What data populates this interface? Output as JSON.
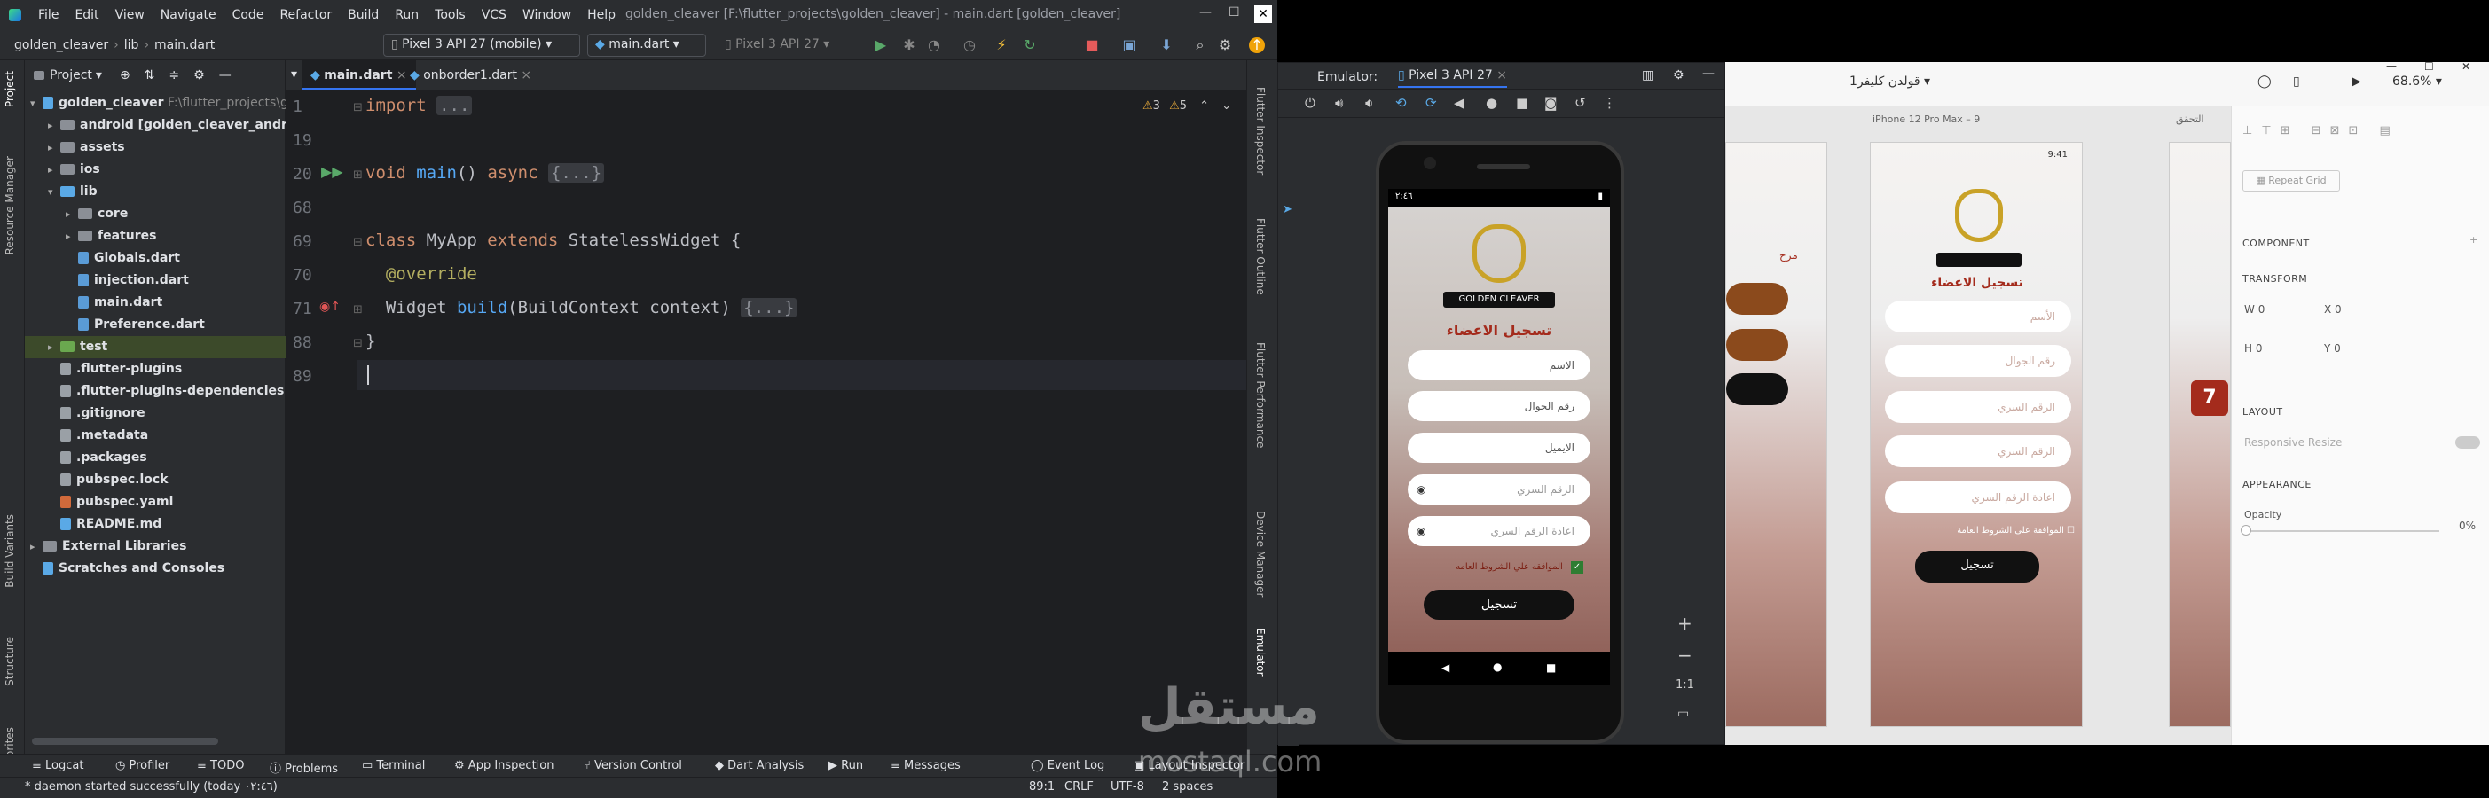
{
  "menu": {
    "items": [
      "File",
      "Edit",
      "View",
      "Navigate",
      "Code",
      "Refactor",
      "Build",
      "Run",
      "Tools",
      "VCS",
      "Window",
      "Help"
    ],
    "title": "golden_cleaver [F:\\flutter_projects\\golden_cleaver] - main.dart [golden_cleaver]"
  },
  "toolbar": {
    "crumbs": [
      "golden_cleaver",
      "lib",
      "main.dart"
    ],
    "device": "Pixel 3 API 27 (mobile)",
    "run_config": "main.dart",
    "emulator_device": "Pixel 3 API 27"
  },
  "side": {
    "project_label": "Project",
    "resource_manager": "Resource Manager",
    "build_variants": "Build Variants",
    "structure": "Structure",
    "favorites": "Favorites"
  },
  "project": {
    "title": "Project",
    "tree": [
      {
        "label": "golden_cleaver",
        "extra": "F:\\flutter_projects\\golden_cleaver"
      },
      {
        "label": "android [golden_cleaver_android]"
      },
      {
        "label": "assets"
      },
      {
        "label": "ios"
      },
      {
        "label": "lib"
      },
      {
        "label": "core"
      },
      {
        "label": "features"
      },
      {
        "label": "Globals.dart"
      },
      {
        "label": "injection.dart"
      },
      {
        "label": "main.dart"
      },
      {
        "label": "Preference.dart"
      },
      {
        "label": "test"
      },
      {
        "label": ".flutter-plugins"
      },
      {
        "label": ".flutter-plugins-dependencies"
      },
      {
        "label": ".gitignore"
      },
      {
        "label": ".metadata"
      },
      {
        "label": ".packages"
      },
      {
        "label": "pubspec.lock"
      },
      {
        "label": "pubspec.yaml"
      },
      {
        "label": "README.md"
      },
      {
        "label": "External Libraries"
      },
      {
        "label": "Scratches and Consoles"
      }
    ]
  },
  "editor": {
    "tabs": [
      "main.dart",
      "onborder1.dart"
    ],
    "warnings": "3",
    "weak": "5",
    "lines": [
      {
        "num": "1",
        "text": "import ..."
      },
      {
        "num": "19",
        "text": ""
      },
      {
        "num": "20",
        "text": "void main() async {...}"
      },
      {
        "num": "68",
        "text": ""
      },
      {
        "num": "69",
        "text": "class MyApp extends StatelessWidget {"
      },
      {
        "num": "70",
        "text": "@override"
      },
      {
        "num": "71",
        "text": "Widget build(BuildContext context) {...}"
      },
      {
        "num": "88",
        "text": "}"
      },
      {
        "num": "89",
        "text": ""
      }
    ]
  },
  "right_strip": [
    "Flutter Inspector",
    "Flutter Outline",
    "Flutter Performance",
    "Device Manager",
    "Emulator"
  ],
  "bottom": {
    "tools": [
      "Logcat",
      "Profiler",
      "TODO",
      "Problems",
      "Terminal",
      "App Inspection",
      "Version Control",
      "Dart Analysis",
      "Run",
      "Messages",
      "Event Log",
      "Layout Inspector"
    ],
    "status": "* daemon started successfully (today ٠٢:٤٦)",
    "position": "89:1",
    "line_sep": "CRLF",
    "encoding": "UTF-8",
    "indent": "2 spaces"
  },
  "emulator": {
    "title": "Emulator:",
    "device": "Pixel 3 API 27",
    "screen": {
      "time": "٢:٤٦",
      "logo_text": "GOLDEN CLEAVER",
      "heading": "تسجيل الاعضاء",
      "fields": [
        "الاسم",
        "رقم الجوال",
        "الايميل",
        "الرقم السري",
        "اعادة الرقم السري"
      ],
      "terms": "الموافقه علي الشروط العامه",
      "register": "تسجيل"
    },
    "zoom_label": "1:1"
  },
  "xd": {
    "doc_title": "قولدن كليفر1",
    "zoom": "68.6%",
    "artboard_label": "iPhone 12 Pro Max – 9",
    "artboard_label_right": "التحقق",
    "artboard_heading": "تسجيل الاعضاء",
    "artboard_fields": [
      "الأسم",
      "رقم الجوال",
      "الرقم السري",
      "الرقم السري",
      "اعادة الرقم السري"
    ],
    "artboard_terms": "الموافقة على الشروط العامة",
    "artboard_button": "تسجيل",
    "artboard_time": "9:41",
    "left_partial": "مرح",
    "right_number": "7",
    "panel": {
      "repeat_grid": "Repeat Grid",
      "component": "COMPONENT",
      "transform": "TRANSFORM",
      "w": "0",
      "x": "0",
      "h": "0",
      "y": "0",
      "layout": "LAYOUT",
      "responsive": "Responsive Resize",
      "appearance": "APPEARANCE",
      "opacity_label": "Opacity",
      "opacity": "0%"
    }
  },
  "watermark": {
    "text": "مستقل",
    "domain": "mostaql.com"
  }
}
